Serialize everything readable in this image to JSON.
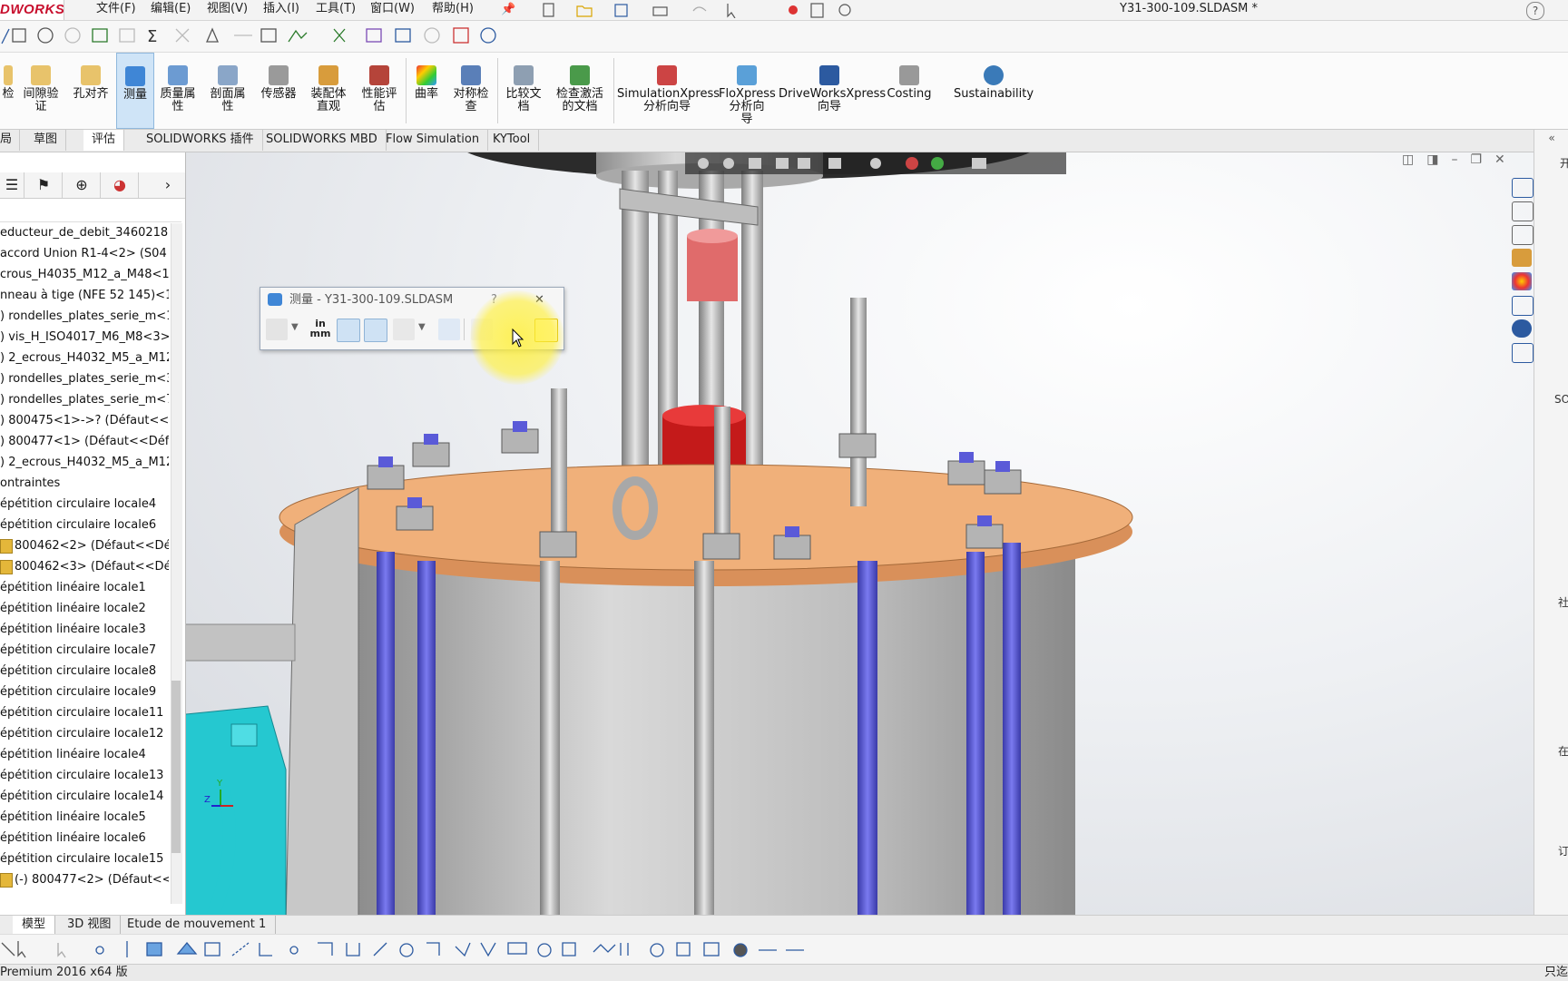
{
  "app": {
    "logo_text": "DWORKS",
    "document_title": "Y31-300-109.SLDASM *"
  },
  "menu": [
    "文件(F)",
    "编辑(E)",
    "视图(V)",
    "插入(I)",
    "工具(T)",
    "窗口(W)",
    "帮助(H)"
  ],
  "command_manager": [
    {
      "label": "检"
    },
    {
      "label": "间隙验\n证"
    },
    {
      "label": "孔对齐"
    },
    {
      "label": "测量",
      "active": true
    },
    {
      "label": "质量属\n性"
    },
    {
      "label": "剖面属\n性"
    },
    {
      "label": "传感器"
    },
    {
      "label": "装配体\n直观"
    },
    {
      "label": "性能评\n估"
    },
    {
      "label": "曲率"
    },
    {
      "label": "对称检\n查"
    },
    {
      "label": "比较文\n档"
    },
    {
      "label": "检查激活\n的文档"
    },
    {
      "label": "SimulationXpress\n分析向导"
    },
    {
      "label": "FloXpress\n分析向\n导"
    },
    {
      "label": "DriveWorksXpress\n向导"
    },
    {
      "label": "Costing"
    },
    {
      "label": "Sustainability"
    }
  ],
  "tabs": [
    "局",
    "草图",
    "评估",
    "SOLIDWORKS 插件",
    "SOLIDWORKS MBD",
    "Flow Simulation",
    "KYTool"
  ],
  "tree": [
    "educteur_de_debit_34602182",
    "accord Union R1-4<2> (S04",
    "crous_H4035_M12_a_M48<1",
    "nneau à tige (NFE 52 145)<1",
    ") rondelles_plates_serie_m<1",
    ") vis_H_ISO4017_M6_M8<3>",
    ") 2_ecrous_H4032_M5_a_M12",
    ") rondelles_plates_serie_m<3",
    ") rondelles_plates_serie_m<7",
    ") 800475<1>->? (Défaut<<D",
    ") 800477<1> (Défaut<<Défa",
    ") 2_ecrous_H4032_M5_a_M12",
    "ontraintes",
    "épétition circulaire locale4",
    "épétition circulaire locale6",
    "800462<2> (Défaut<<Déf",
    "800462<3> (Défaut<<Déf",
    "épétition linéaire locale1",
    "épétition linéaire locale2",
    "épétition linéaire locale3",
    "épétition circulaire locale7",
    "épétition circulaire locale8",
    "épétition circulaire locale9",
    "épétition circulaire locale11",
    "épétition circulaire locale12",
    "épétition linéaire locale4",
    "épétition circulaire locale13",
    "épétition circulaire locale14",
    "épétition linéaire locale5",
    "épétition linéaire locale6",
    "épétition circulaire locale15",
    "(-) 800477<2> (Défaut<<I"
  ],
  "measure_dialog": {
    "title": "测量 - Y31-300-109.SLDASM",
    "help": "?",
    "close": "✕",
    "units_top": "in",
    "units_bottom": "mm"
  },
  "bottom_tabs": [
    "模型",
    "3D 视图",
    "Etude de mouvement 1"
  ],
  "status": {
    "text": "Premium 2016 x64 版",
    "right": "只迄"
  },
  "triad": {
    "y": "Y",
    "z": "Z"
  },
  "task_pane_labels": [
    "开",
    "SO",
    "社",
    "在",
    "订"
  ],
  "colors": {
    "accent": "#c8102e",
    "active_tab": "#cfe4f7",
    "plate": "#f0b07a",
    "rod_blue": "#5b5bd6",
    "body_gray": "#c7c7c7",
    "cyan": "#25c8d0"
  }
}
